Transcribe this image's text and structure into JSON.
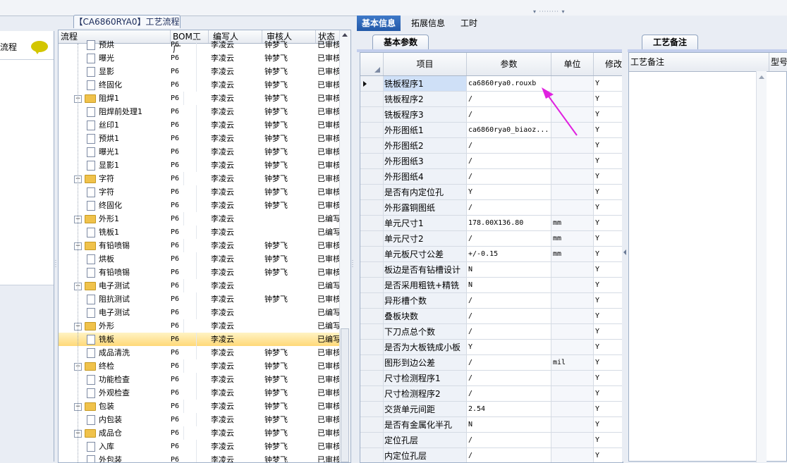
{
  "left_panel": {
    "label": "流程"
  },
  "tree": {
    "title": "【CA6860RYA0】工艺流程",
    "columns": [
      "流程",
      "BOM工厂",
      "编写人",
      "审核人",
      "状态"
    ],
    "rows": [
      {
        "name": "预烘",
        "bom": "P6",
        "by": "李凌云",
        "rev": "钟梦飞",
        "status": "已审核",
        "level": 2
      },
      {
        "name": "曝光",
        "bom": "P6",
        "by": "李凌云",
        "rev": "钟梦飞",
        "status": "已审核",
        "level": 2
      },
      {
        "name": "显影",
        "bom": "P6",
        "by": "李凌云",
        "rev": "钟梦飞",
        "status": "已审核",
        "level": 2
      },
      {
        "name": "终固化",
        "bom": "P6",
        "by": "李凌云",
        "rev": "钟梦飞",
        "status": "已审核",
        "level": 2
      },
      {
        "name": "阻焊1",
        "bom": "P6",
        "by": "李凌云",
        "rev": "钟梦飞",
        "status": "已审核",
        "level": 1
      },
      {
        "name": "阻焊前处理1",
        "bom": "P6",
        "by": "李凌云",
        "rev": "钟梦飞",
        "status": "已审核",
        "level": 2
      },
      {
        "name": "丝印1",
        "bom": "P6",
        "by": "李凌云",
        "rev": "钟梦飞",
        "status": "已审核",
        "level": 2
      },
      {
        "name": "预烘1",
        "bom": "P6",
        "by": "李凌云",
        "rev": "钟梦飞",
        "status": "已审核",
        "level": 2
      },
      {
        "name": "曝光1",
        "bom": "P6",
        "by": "李凌云",
        "rev": "钟梦飞",
        "status": "已审核",
        "level": 2
      },
      {
        "name": "显影1",
        "bom": "P6",
        "by": "李凌云",
        "rev": "钟梦飞",
        "status": "已审核",
        "level": 2
      },
      {
        "name": "字符",
        "bom": "P6",
        "by": "李凌云",
        "rev": "钟梦飞",
        "status": "已审核",
        "level": 1
      },
      {
        "name": "字符",
        "bom": "P6",
        "by": "李凌云",
        "rev": "钟梦飞",
        "status": "已审核",
        "level": 2
      },
      {
        "name": "终固化",
        "bom": "P6",
        "by": "李凌云",
        "rev": "钟梦飞",
        "status": "已审核",
        "level": 2
      },
      {
        "name": "外形1",
        "bom": "P6",
        "by": "李凌云",
        "rev": "",
        "status": "已编写",
        "level": 1
      },
      {
        "name": "铣板1",
        "bom": "P6",
        "by": "李凌云",
        "rev": "",
        "status": "已编写",
        "level": 2
      },
      {
        "name": "有铅喷锡",
        "bom": "P6",
        "by": "李凌云",
        "rev": "钟梦飞",
        "status": "已审核",
        "level": 1
      },
      {
        "name": "烘板",
        "bom": "P6",
        "by": "李凌云",
        "rev": "钟梦飞",
        "status": "已审核",
        "level": 2
      },
      {
        "name": "有铅喷锡",
        "bom": "P6",
        "by": "李凌云",
        "rev": "钟梦飞",
        "status": "已审核",
        "level": 2
      },
      {
        "name": "电子测试",
        "bom": "P6",
        "by": "李凌云",
        "rev": "",
        "status": "已编写",
        "level": 1
      },
      {
        "name": "阻抗测试",
        "bom": "P6",
        "by": "李凌云",
        "rev": "钟梦飞",
        "status": "已审核",
        "level": 2
      },
      {
        "name": "电子测试",
        "bom": "P6",
        "by": "李凌云",
        "rev": "",
        "status": "已编写",
        "level": 2
      },
      {
        "name": "外形",
        "bom": "P6",
        "by": "李凌云",
        "rev": "",
        "status": "已编写",
        "level": 1
      },
      {
        "name": "铣板",
        "bom": "P6",
        "by": "李凌云",
        "rev": "",
        "status": "已编写",
        "level": 2,
        "selected": true
      },
      {
        "name": "成品清洗",
        "bom": "P6",
        "by": "李凌云",
        "rev": "钟梦飞",
        "status": "已审核",
        "level": 2
      },
      {
        "name": "终检",
        "bom": "P6",
        "by": "李凌云",
        "rev": "钟梦飞",
        "status": "已审核",
        "level": 1
      },
      {
        "name": "功能检查",
        "bom": "P6",
        "by": "李凌云",
        "rev": "钟梦飞",
        "status": "已审核",
        "level": 2
      },
      {
        "name": "外观检查",
        "bom": "P6",
        "by": "李凌云",
        "rev": "钟梦飞",
        "status": "已审核",
        "level": 2
      },
      {
        "name": "包装",
        "bom": "P6",
        "by": "李凌云",
        "rev": "钟梦飞",
        "status": "已审核",
        "level": 1
      },
      {
        "name": "内包装",
        "bom": "P6",
        "by": "李凌云",
        "rev": "钟梦飞",
        "status": "已审核",
        "level": 2
      },
      {
        "name": "成品仓",
        "bom": "P6",
        "by": "李凌云",
        "rev": "钟梦飞",
        "status": "已审核",
        "level": 1
      },
      {
        "name": "入库",
        "bom": "P6",
        "by": "李凌云",
        "rev": "钟梦飞",
        "status": "已审核",
        "level": 2
      },
      {
        "name": "外包装",
        "bom": "P6",
        "by": "李凌云",
        "rev": "钟梦飞",
        "status": "已审核",
        "level": 2
      }
    ]
  },
  "tabs": [
    "基本信息",
    "拓展信息",
    "工时"
  ],
  "param_panel": {
    "subtab": "基本参数",
    "columns": [
      "项目",
      "参数",
      "单位",
      "修改"
    ],
    "rows": [
      {
        "item": "铣板程序1",
        "value": "ca6860rya0.rouxb",
        "unit": "",
        "mod": "Y",
        "current": true
      },
      {
        "item": "铣板程序2",
        "value": "/",
        "unit": "",
        "mod": "Y"
      },
      {
        "item": "铣板程序3",
        "value": "/",
        "unit": "",
        "mod": "Y"
      },
      {
        "item": "外形图纸1",
        "value": "ca6860rya0_biaoz...",
        "unit": "",
        "mod": "Y"
      },
      {
        "item": "外形图纸2",
        "value": "/",
        "unit": "",
        "mod": "Y"
      },
      {
        "item": "外形图纸3",
        "value": "/",
        "unit": "",
        "mod": "Y"
      },
      {
        "item": "外形图纸4",
        "value": "/",
        "unit": "",
        "mod": "Y"
      },
      {
        "item": "是否有内定位孔",
        "value": "Y",
        "unit": "",
        "mod": "Y"
      },
      {
        "item": "外形露铜图纸",
        "value": "/",
        "unit": "",
        "mod": "Y"
      },
      {
        "item": "单元尺寸1",
        "value": "178.00X136.80",
        "unit": "mm",
        "mod": "Y"
      },
      {
        "item": "单元尺寸2",
        "value": "/",
        "unit": "mm",
        "mod": "Y"
      },
      {
        "item": "单元板尺寸公差",
        "value": "+/-0.15",
        "unit": "mm",
        "mod": "Y"
      },
      {
        "item": "板边是否有钻槽设计",
        "value": "N",
        "unit": "",
        "mod": "Y"
      },
      {
        "item": "是否采用粗铣+精铣",
        "value": "N",
        "unit": "",
        "mod": "Y"
      },
      {
        "item": "异形槽个数",
        "value": "/",
        "unit": "",
        "mod": "Y"
      },
      {
        "item": "叠板块数",
        "value": "/",
        "unit": "",
        "mod": "Y"
      },
      {
        "item": "下刀点总个数",
        "value": "/",
        "unit": "",
        "mod": "Y"
      },
      {
        "item": "是否为大板铣成小板",
        "value": "Y",
        "unit": "",
        "mod": "Y"
      },
      {
        "item": "图形到边公差",
        "value": "/",
        "unit": "mil",
        "mod": "Y"
      },
      {
        "item": "尺寸检测程序1",
        "value": "/",
        "unit": "",
        "mod": "Y"
      },
      {
        "item": "尺寸检测程序2",
        "value": "/",
        "unit": "",
        "mod": "Y"
      },
      {
        "item": "交货单元间距",
        "value": "2.54",
        "unit": "",
        "mod": "Y"
      },
      {
        "item": "是否有金属化半孔",
        "value": "N",
        "unit": "",
        "mod": "Y"
      },
      {
        "item": "定位孔层",
        "value": "/",
        "unit": "",
        "mod": "Y"
      },
      {
        "item": "内定位孔层",
        "value": "/",
        "unit": "",
        "mod": "Y"
      }
    ]
  },
  "notes_panel": {
    "subtab": "工艺备注",
    "columns": [
      "工艺备注",
      "型号"
    ]
  },
  "colors": {
    "active_tab": "#2f69b8",
    "selection": "#ffd978",
    "annotation_arrow": "#e021e0"
  }
}
